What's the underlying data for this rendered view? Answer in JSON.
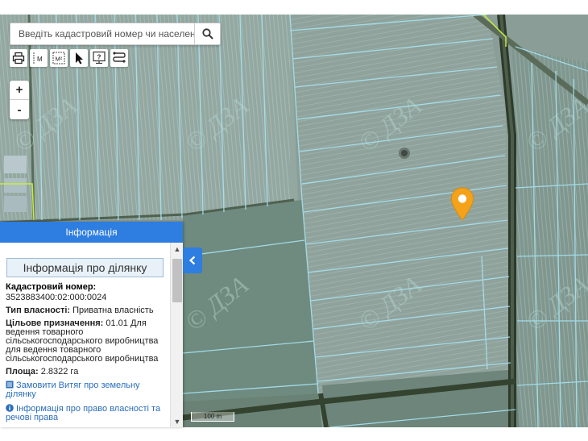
{
  "search": {
    "placeholder": "Введіть кадастровий номер чи населений"
  },
  "toolbar": {
    "icons": [
      "print-icon",
      "measure-length-icon",
      "measure-area-icon",
      "pointer-icon",
      "info-icon",
      "route-icon"
    ],
    "measure_length_label": "M",
    "measure_area_label": "M²",
    "info_label": "?"
  },
  "zoom": {
    "in_label": "+",
    "out_label": "-"
  },
  "info_panel": {
    "header": "Інформація",
    "title": "Інформація про ділянку",
    "cadastral_label": "Кадастровий номер:",
    "cadastral_value": "3523883400:02:000:0024",
    "ownership_label": "Тип власності:",
    "ownership_value": " Приватна власність",
    "purpose_label": "Цільове призначення:",
    "purpose_value": " 01.01 Для ведення товарного сільськогосподарського виробництва для ведення товарного сільськогосподарського виробництва",
    "area_label": "Площа:",
    "area_value": " 2.8322 га",
    "link_extract": "Замовити Витяг про земельну ділянку",
    "link_rights": "Інформація про право власності та речові права"
  },
  "map": {
    "watermark": "© ДЗА",
    "scale_label": "100 m",
    "marker_color": "#f4a21a",
    "parcel_line_color": "#a6e3f2",
    "accent_color": "#2e7de0"
  }
}
